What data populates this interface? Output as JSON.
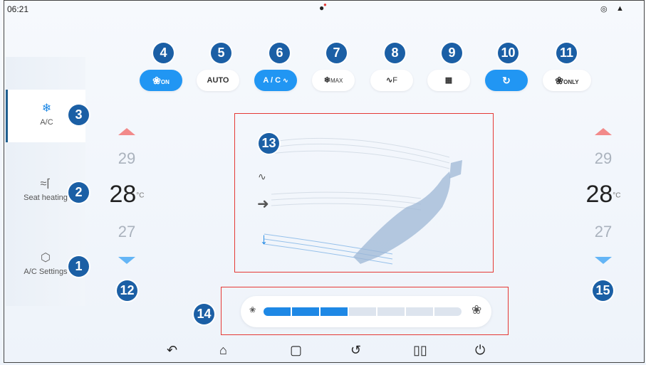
{
  "status": {
    "time": "06:21",
    "icons": [
      "location-icon",
      "signal-icon"
    ]
  },
  "sidebar": {
    "items": [
      {
        "label": "A/C",
        "icon": "snowflake-icon",
        "badge": "3"
      },
      {
        "label": "Seat heating",
        "icon": "seat-heat-icon",
        "badge": "2"
      },
      {
        "label": "A/C Settings",
        "icon": "hex-settings-icon",
        "badge": "1"
      }
    ]
  },
  "top_buttons": [
    {
      "label": "ON",
      "icon": "fan-icon",
      "badge": "4",
      "active": true
    },
    {
      "label": "AUTO",
      "badge": "5",
      "active": false
    },
    {
      "label": "A / C",
      "icon": "heat-waves-icon",
      "badge": "6",
      "active": true
    },
    {
      "label": "MAX",
      "icon": "snowflake-icon",
      "badge": "7",
      "active": false
    },
    {
      "label": "F",
      "icon": "front-defrost-icon",
      "badge": "8",
      "active": false
    },
    {
      "label": "",
      "icon": "rear-defrost-icon",
      "badge": "9",
      "active": false
    },
    {
      "label": "",
      "icon": "recirculation-car-icon",
      "badge": "10",
      "active": true
    },
    {
      "label": "ONLY",
      "icon": "fan-icon",
      "badge": "11",
      "active": false
    }
  ],
  "left_temp": {
    "upper": "29",
    "current": "28",
    "lower": "27",
    "unit": "°C",
    "badge": "12"
  },
  "right_temp": {
    "upper": "29",
    "current": "28",
    "lower": "27",
    "unit": "°C",
    "badge": "15"
  },
  "airflow": {
    "badge": "13"
  },
  "fan": {
    "badge": "14",
    "segments_total": 7,
    "segments_on": 3
  },
  "navbar": [
    "back-icon",
    "home-icon",
    "recent-apps-icon",
    "rotate-icon",
    "split-screen-icon",
    "power-icon"
  ],
  "colors": {
    "accent": "#2196f3",
    "badge": "#1b5fa5",
    "highlight_box": "#e53935"
  }
}
